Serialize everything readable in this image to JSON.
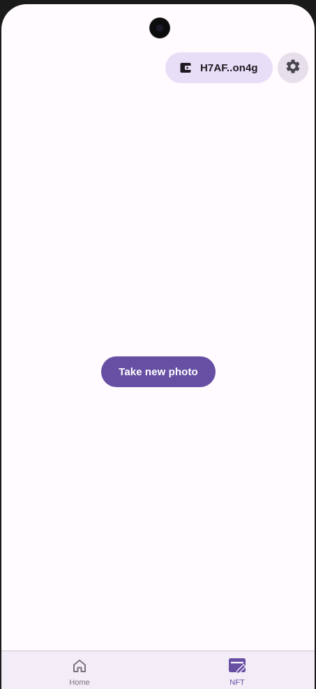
{
  "header": {
    "wallet_label": "H7AF..on4g",
    "wallet_icon": "wallet-icon",
    "settings_icon": "gear-icon"
  },
  "main": {
    "primary_action_label": "Take new photo"
  },
  "bottom_nav": {
    "items": [
      {
        "label": "Home",
        "icon": "home-icon",
        "selected": false
      },
      {
        "label": "NFT",
        "icon": "nft-edit-icon",
        "selected": true
      }
    ]
  },
  "colors": {
    "background": "#fffbfe",
    "primary": "#6750a4",
    "chip": "#e8def8",
    "nav_background": "#f3edf7",
    "inactive": "#79747e"
  }
}
